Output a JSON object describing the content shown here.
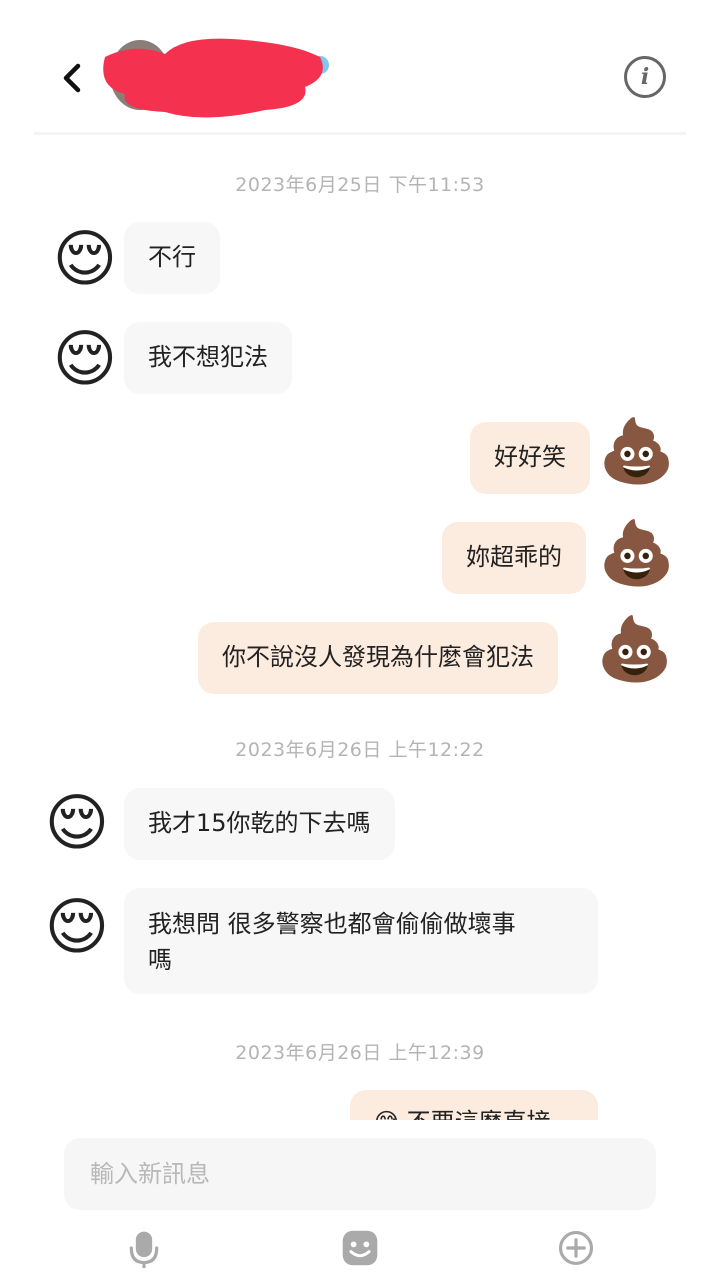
{
  "header": {
    "contact_name": "",
    "back_icon": "chevron-left-icon",
    "info_icon": "info-circle-icon",
    "info_glyph": "i"
  },
  "messages": {
    "ts1": "2023年6月25日 下午11:53",
    "m1": "不行",
    "m2": "我不想犯法",
    "m3": "好好笑",
    "m4": "妳超乖的",
    "m5": "你不說沒人發現為什麼會犯法",
    "ts2": "2023年6月26日 上午12:22",
    "m6": "我才15你乾的下去嗎",
    "m7_line1": "我想問 很多警察也都會偷偷做壞事",
    "m7_line2": "嗎",
    "ts3": "2023年6月26日 上午12:39",
    "m8_partial": "😅 不要這麼直接"
  },
  "emoji": {
    "incoming": "😌",
    "outgoing": "💩"
  },
  "composer": {
    "placeholder": "輸入新訊息"
  },
  "toolbar": {
    "mic_icon": "microphone-icon",
    "sticker_icon": "sticker-smile-icon",
    "add_icon": "plus-circle-icon"
  },
  "colors": {
    "incoming_bubble": "#f7f7f7",
    "outgoing_bubble": "#fcebdf",
    "timestamp": "#b4b4b4",
    "icon_gray": "#aaaaaa",
    "redaction": "#f4314f"
  }
}
